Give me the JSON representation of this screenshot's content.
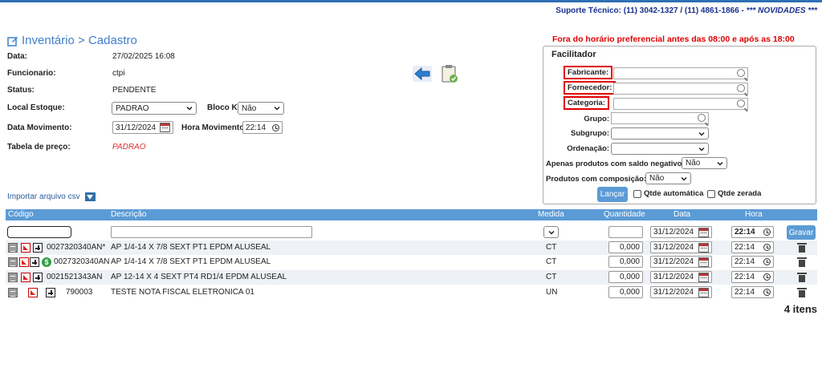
{
  "support": {
    "text": "Suporte Técnico: (11) 3042-1327 / (11) 4861-1866 - ",
    "novidades": "*** NOVIDADES ***"
  },
  "page": {
    "title": "Inventário > Cadastro",
    "warning": "Fora do horário preferencial antes das 08:00 e após as 18:00"
  },
  "form": {
    "data_label": "Data:",
    "data_value": "27/02/2025 16:08",
    "funcionario_label": "Funcionario:",
    "funcionario_value": "ctpi",
    "status_label": "Status:",
    "status_value": "PENDENTE",
    "local_label": "Local Estoque:",
    "local_value": "PADRAO",
    "blocok_label": "Bloco K:",
    "blocok_value": "Não",
    "datamov_label": "Data Movimento:",
    "datamov_value": "31/12/2024",
    "horamov_label": "Hora Movimento:",
    "horamov_value": "22:14",
    "tabela_label": "Tabela de preço:",
    "tabela_value": "PADRAO"
  },
  "import": {
    "label": "Importar arquivo csv"
  },
  "facilitador": {
    "title": "Facilitador",
    "fabricante": "Fabricante:",
    "fornecedor": "Fornecedor:",
    "categoria": "Categoria:",
    "grupo": "Grupo:",
    "subgrupo": "Subgrupo:",
    "ordenacao": "Ordenação:",
    "saldo_label": "Apenas produtos com saldo negativo:",
    "saldo_value": "Não",
    "composicao_label": "Produtos com composição:",
    "composicao_value": "Não",
    "lancar": "Lançar",
    "qtde_auto": "Qtde automática",
    "qtde_zerada": "Qtde zerada"
  },
  "table": {
    "headers": {
      "codigo": "Código",
      "descricao": "Descrição",
      "medida": "Medida",
      "quantidade": "Quantidade",
      "data": "Data",
      "hora": "Hora"
    },
    "entry": {
      "data": "31/12/2024",
      "hora": "22:14",
      "gravar": "Gravar"
    },
    "rows": [
      {
        "codigo": "0027320340AN*",
        "descricao": "AP 1/4-14 X 7/8 SEXT PT1 EPDM ALUSEAL",
        "medida": "CT",
        "quantidade": "0,000",
        "data": "31/12/2024",
        "hora": "22:14"
      },
      {
        "codigo": "0027320340AN",
        "descricao": "AP 1/4-14 X 7/8 SEXT PT1 EPDM ALUSEAL",
        "medida": "CT",
        "quantidade": "0,000",
        "data": "31/12/2024",
        "hora": "22:14"
      },
      {
        "codigo": "0021521343AN",
        "descricao": "AP 12-14 X 4 SEXT PT4 RD1/4 EPDM ALUSEAL",
        "medida": "CT",
        "quantidade": "0,000",
        "data": "31/12/2024",
        "hora": "22:14"
      },
      {
        "codigo": "790003",
        "descricao": "TESTE NOTA FISCAL ELETRONICA 01",
        "medida": "UN",
        "quantidade": "0,000",
        "data": "31/12/2024",
        "hora": "22:14"
      }
    ],
    "count": "4 itens"
  }
}
